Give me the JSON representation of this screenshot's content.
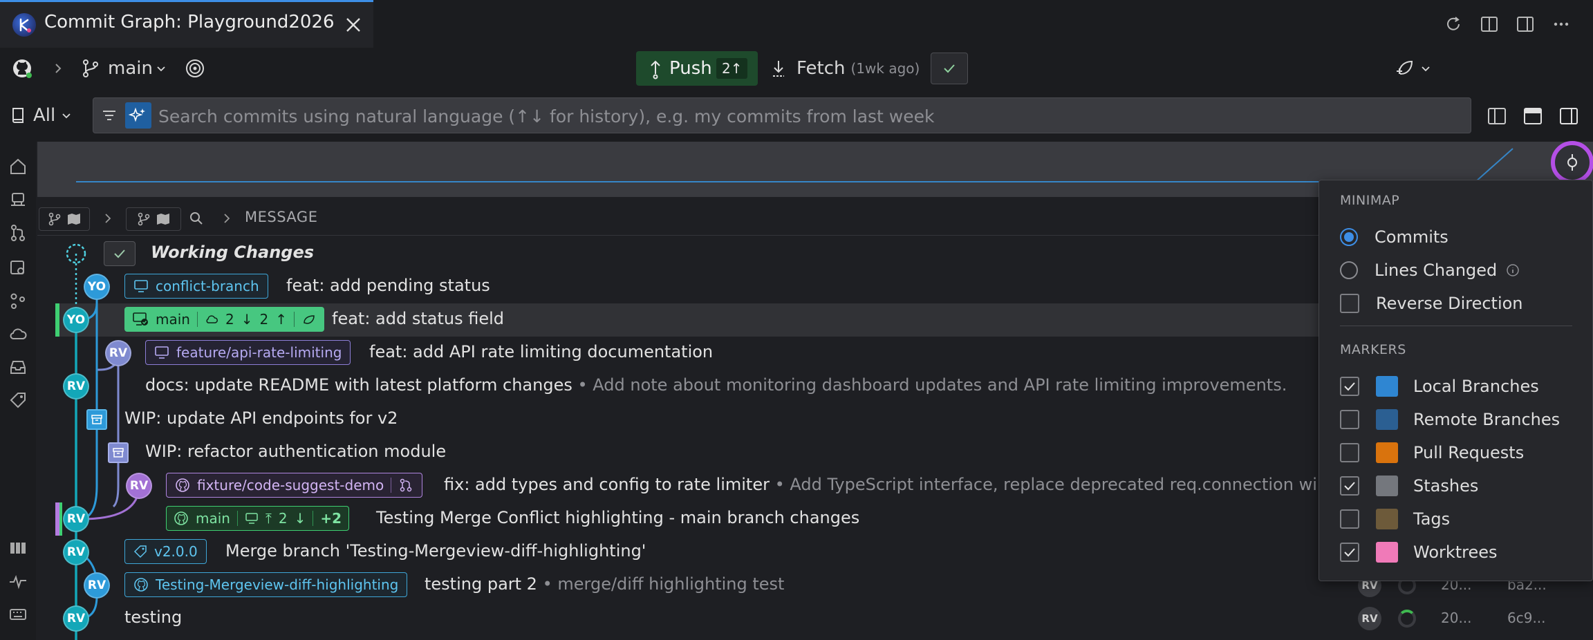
{
  "tab": {
    "title": "Commit Graph: Playground2026"
  },
  "toolbar": {
    "branch": "main",
    "push_label": "Push",
    "push_count": "2↑",
    "fetch_label": "Fetch",
    "fetch_time": "(1wk ago)"
  },
  "search": {
    "scope": "All",
    "placeholder": "Search commits using natural language (↑↓ for history), e.g. my commits from last week"
  },
  "columns": {
    "message": "MESSAGE"
  },
  "rows": [
    {
      "message": "Working Changes"
    },
    {
      "author": "YO",
      "ref": "conflict-branch",
      "message": "feat: add pending status"
    },
    {
      "author": "YO",
      "ref": "main",
      "ref_status": "2",
      "ref_ahead": "2",
      "message": "feat: add status field"
    },
    {
      "author": "RV",
      "ref": "feature/api-rate-limiting",
      "message": "feat: add API rate limiting documentation"
    },
    {
      "author": "RV",
      "message": "docs: update README with latest platform changes",
      "description": "• Add note about monitoring dashboard updates and API rate limiting improvements."
    },
    {
      "message": "WIP: update API endpoints for v2"
    },
    {
      "message": "WIP: refactor authentication module"
    },
    {
      "author": "RV",
      "ref": "fixture/code-suggest-demo",
      "message": "fix: add types and config to rate limiter",
      "description": "• Add TypeScript interface, replace deprecated req.connection wi"
    },
    {
      "author": "RV",
      "ref": "main",
      "ref_status": "2",
      "ref_extra": "+2",
      "message": "Testing Merge Conflict highlighting - main branch changes"
    },
    {
      "author": "RV",
      "ref": "v2.0.0",
      "message": "Merge branch 'Testing-Mergeview-diff-highlighting'"
    },
    {
      "author": "RV",
      "ref": "Testing-Mergeview-diff-highlighting",
      "message": "testing part 2",
      "description": "• merge/diff highlighting test",
      "row_author": "RV",
      "date": "20...",
      "sha": "ba2..."
    },
    {
      "author": "RV",
      "message": "testing",
      "row_author": "RV",
      "date": "20...",
      "sha": "6c9..."
    }
  ],
  "minimap_menu": {
    "section_minimap": "MINIMAP",
    "radio_commits": "Commits",
    "radio_lines": "Lines Changed",
    "reverse": "Reverse Direction",
    "section_markers": "MARKERS",
    "markers": [
      {
        "label": "Local Branches",
        "checked": true,
        "color": "#2f86d2"
      },
      {
        "label": "Remote Branches",
        "checked": false,
        "color": "#2b5f92"
      },
      {
        "label": "Pull Requests",
        "checked": false,
        "color": "#d9730d"
      },
      {
        "label": "Stashes",
        "checked": true,
        "color": "#74777d"
      },
      {
        "label": "Tags",
        "checked": false,
        "color": "#6d5a3a"
      },
      {
        "label": "Worktrees",
        "checked": true,
        "color": "#f07ab8"
      }
    ]
  }
}
